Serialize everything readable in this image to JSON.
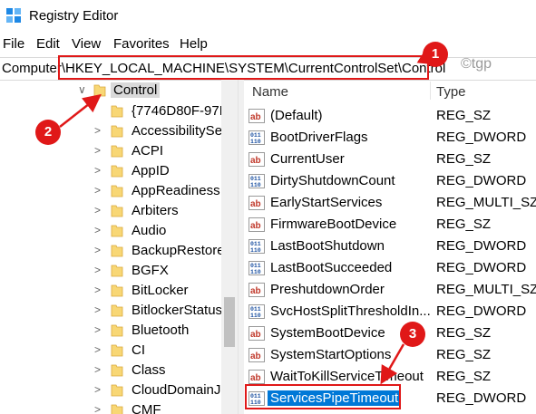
{
  "window": {
    "title": "Registry Editor"
  },
  "menu": [
    "File",
    "Edit",
    "View",
    "Favorites",
    "Help"
  ],
  "address": {
    "path": "Computer\\HKEY_LOCAL_MACHINE\\SYSTEM\\CurrentControlSet\\Control"
  },
  "watermark": "©tgp",
  "tree": {
    "selected": "Control",
    "children": [
      "{7746D80F-97E",
      "AccessibilitySe",
      "ACPI",
      "AppID",
      "AppReadiness",
      "Arbiters",
      "Audio",
      "BackupRestore",
      "BGFX",
      "BitLocker",
      "BitlockerStatus",
      "Bluetooth",
      "CI",
      "Class",
      "CloudDomainJ",
      "CMF"
    ]
  },
  "values_pane": {
    "headers": {
      "name": "Name",
      "type": "Type"
    },
    "rows": [
      {
        "name": "(Default)",
        "type": "REG_SZ",
        "icon": "string-value-icon"
      },
      {
        "name": "BootDriverFlags",
        "type": "REG_DWORD",
        "icon": "binary-value-icon"
      },
      {
        "name": "CurrentUser",
        "type": "REG_SZ",
        "icon": "string-value-icon"
      },
      {
        "name": "DirtyShutdownCount",
        "type": "REG_DWORD",
        "icon": "binary-value-icon"
      },
      {
        "name": "EarlyStartServices",
        "type": "REG_MULTI_SZ",
        "icon": "string-value-icon"
      },
      {
        "name": "FirmwareBootDevice",
        "type": "REG_SZ",
        "icon": "string-value-icon"
      },
      {
        "name": "LastBootShutdown",
        "type": "REG_DWORD",
        "icon": "binary-value-icon"
      },
      {
        "name": "LastBootSucceeded",
        "type": "REG_DWORD",
        "icon": "binary-value-icon"
      },
      {
        "name": "PreshutdownOrder",
        "type": "REG_MULTI_SZ",
        "icon": "string-value-icon"
      },
      {
        "name": "SvcHostSplitThresholdIn...",
        "type": "REG_DWORD",
        "icon": "binary-value-icon"
      },
      {
        "name": "SystemBootDevice",
        "type": "REG_SZ",
        "icon": "string-value-icon"
      },
      {
        "name": "SystemStartOptions",
        "type": "REG_SZ",
        "icon": "string-value-icon"
      },
      {
        "name": "WaitToKillServiceTimeout",
        "type": "REG_SZ",
        "icon": "string-value-icon"
      },
      {
        "name": "ServicesPipeTimeout",
        "type": "REG_DWORD",
        "icon": "binary-value-icon",
        "selected": true
      }
    ]
  },
  "callouts": [
    "1",
    "2",
    "3"
  ],
  "colors": {
    "callout": "#e01818",
    "selection": "#0078d7",
    "folder": "#f8d775"
  }
}
